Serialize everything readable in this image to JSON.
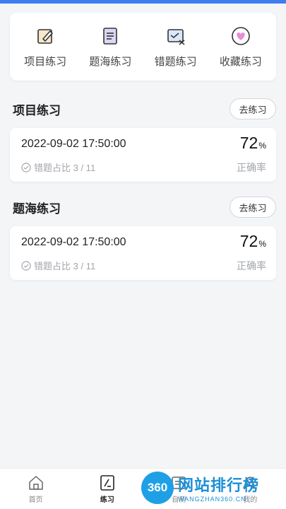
{
  "quick_actions": [
    {
      "label": "项目练习",
      "icon": "edit-note-icon"
    },
    {
      "label": "题海练习",
      "icon": "document-list-icon"
    },
    {
      "label": "错题练习",
      "icon": "wrong-answer-icon"
    },
    {
      "label": "收藏练习",
      "icon": "heart-icon"
    }
  ],
  "sections": [
    {
      "title": "项目练习",
      "button_label": "去练习",
      "record": {
        "date": "2022-09-02 17:50:00",
        "wrong_ratio": "错题占比 3 / 11",
        "rate": "72",
        "rate_unit": "%",
        "rate_label": "正确率"
      }
    },
    {
      "title": "题海练习",
      "button_label": "去练习",
      "record": {
        "date": "2022-09-02 17:50:00",
        "wrong_ratio": "错题占比 3 / 11",
        "rate": "72",
        "rate_unit": "%",
        "rate_label": "正确率"
      }
    }
  ],
  "tabbar": [
    {
      "label": "首页",
      "icon": "home-icon",
      "active": false
    },
    {
      "label": "练习",
      "icon": "practice-icon",
      "active": true
    },
    {
      "label": "自测",
      "icon": "test-icon",
      "active": false
    },
    {
      "label": "我的",
      "icon": "profile-icon",
      "active": false
    }
  ],
  "watermark": {
    "logo": "360",
    "title": "网站排行榜",
    "sub": "WANGZHAN360.CN"
  },
  "colors": {
    "accent": "#3f7cf0",
    "heart": "#e58fd8",
    "watermark": "#1c8fd8"
  }
}
